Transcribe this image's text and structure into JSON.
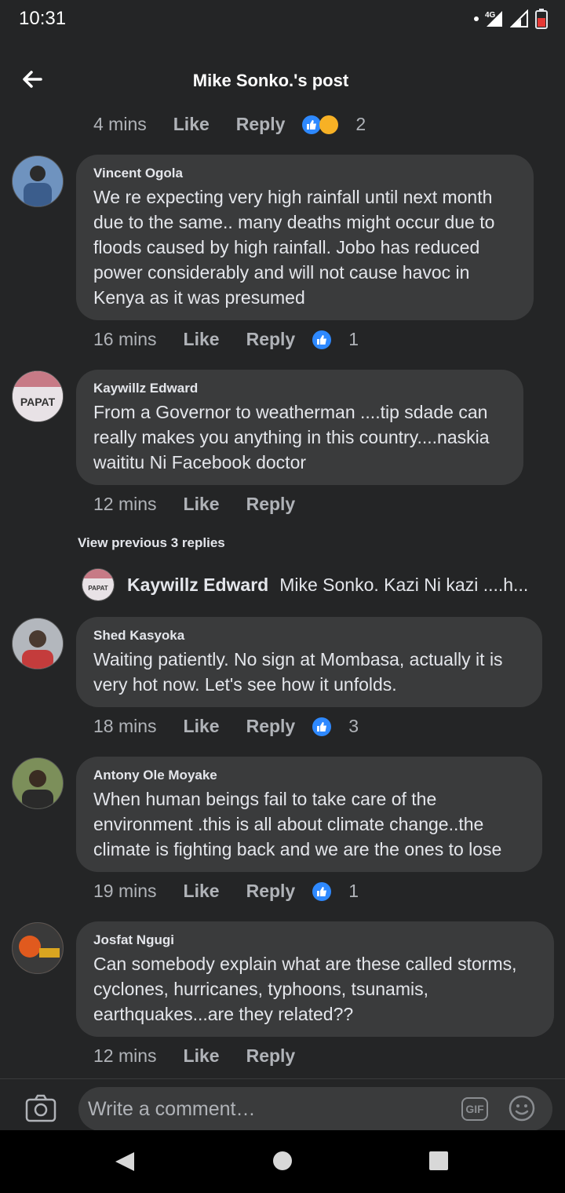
{
  "status_bar": {
    "time": "10:31",
    "network": "4G"
  },
  "header": {
    "title": "Mike Sonko.'s post"
  },
  "top_meta": {
    "time": "4 mins",
    "like": "Like",
    "reply": "Reply",
    "reaction_count": "2"
  },
  "comments": [
    {
      "author": "Vincent Ogola",
      "text": "We re expecting very high rainfall until next month due to the same.. many deaths might occur due to floods caused by high rainfall. Jobo has reduced power considerably and will not cause havoc in Kenya as it was presumed",
      "time": "16 mins",
      "like": "Like",
      "reply": "Reply",
      "reaction_count": "1"
    },
    {
      "author": "Kaywillz Edward",
      "avatar_text": "PAPAT",
      "text": "From a Governor to weatherman ....tip sdade can really makes you anything in this country....naskia waititu Ni Facebook doctor",
      "time": "12 mins",
      "like": "Like",
      "reply": "Reply"
    },
    {
      "author": "Shed Kasyoka",
      "text": "Waiting patiently. No sign at Mombasa, actually it is very hot now. Let's see how it unfolds.",
      "time": "18 mins",
      "like": "Like",
      "reply": "Reply",
      "reaction_count": "3"
    },
    {
      "author": "Antony Ole Moyake",
      "text": "When human beings fail to take care of the environment .this is all about climate change..the climate is fighting back and we are the ones to lose",
      "time": "19 mins",
      "like": "Like",
      "reply": "Reply",
      "reaction_count": "1"
    },
    {
      "author": "Josfat Ngugi",
      "text": "Can somebody explain what are these called storms, cyclones, hurricanes, typhoons, tsunamis, earthquakes...are they related??",
      "time": "12 mins",
      "like": "Like",
      "reply": "Reply"
    }
  ],
  "view_previous": "View previous 3 replies",
  "reply_preview": {
    "author": "Kaywillz Edward",
    "avatar_text": "PAPAT",
    "text": "Mike Sonko. Kazi Ni kazi ....h..."
  },
  "composer": {
    "placeholder": "Write a comment…",
    "gif_label": "GIF"
  },
  "colors": {
    "background": "#242526",
    "bubble": "#3a3b3c",
    "like_blue": "#2e89ff",
    "meta_text": "#b0b3b8"
  }
}
